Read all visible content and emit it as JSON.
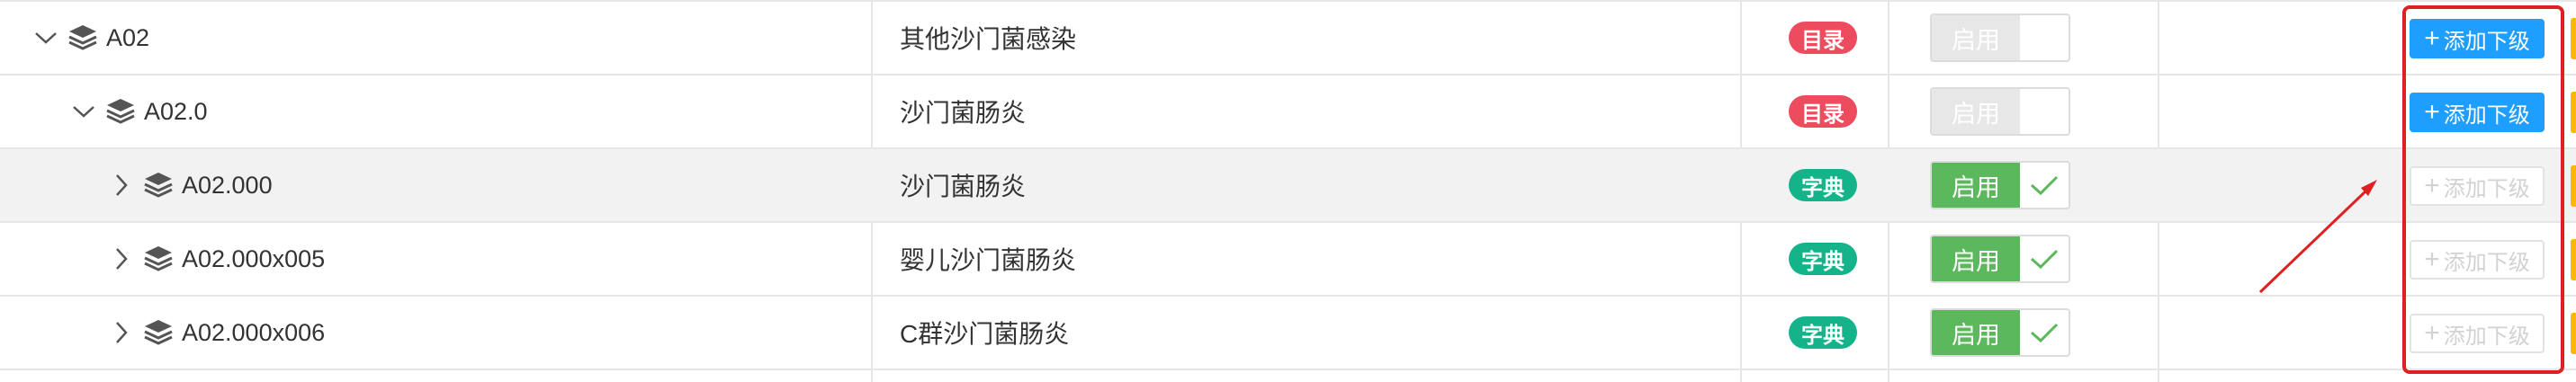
{
  "colors": {
    "catalog_badge": "#ed4b5e",
    "dict_badge": "#15b38a",
    "switch_on": "#5cb85c",
    "switch_off": "#e7e7e7",
    "add_enabled": "#1e9fff",
    "annotation": "#e02020"
  },
  "rows": [
    {
      "code": "A02",
      "name": "其他沙门菌感染",
      "badge": "目录",
      "badge_type": "catalog",
      "expanded": true,
      "status_label": "启用",
      "status_on": false,
      "add_label": "添加下级",
      "add_enabled": true
    },
    {
      "code": "A02.0",
      "name": "沙门菌肠炎",
      "badge": "目录",
      "badge_type": "catalog",
      "expanded": true,
      "status_label": "启用",
      "status_on": false,
      "add_label": "添加下级",
      "add_enabled": true
    },
    {
      "code": "A02.000",
      "name": "沙门菌肠炎",
      "badge": "字典",
      "badge_type": "dict",
      "expanded": false,
      "status_label": "启用",
      "status_on": true,
      "add_label": "添加下级",
      "add_enabled": false
    },
    {
      "code": "A02.000x005",
      "name": "婴儿沙门菌肠炎",
      "badge": "字典",
      "badge_type": "dict",
      "expanded": false,
      "status_label": "启用",
      "status_on": true,
      "add_label": "添加下级",
      "add_enabled": false
    },
    {
      "code": "A02.000x006",
      "name": "C群沙门菌肠炎",
      "badge": "字典",
      "badge_type": "dict",
      "expanded": false,
      "status_label": "启用",
      "status_on": true,
      "add_label": "添加下级",
      "add_enabled": false
    }
  ]
}
